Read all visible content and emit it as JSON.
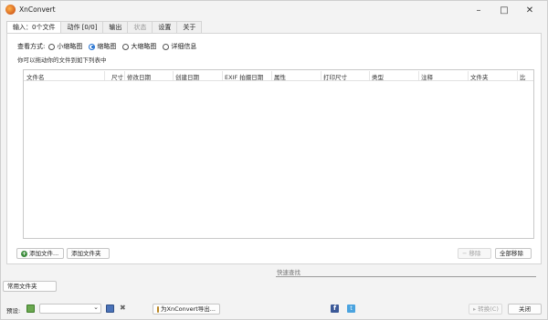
{
  "window": {
    "title": "XnConvert"
  },
  "tabs": [
    {
      "label": "输入：0个文件",
      "state": "active"
    },
    {
      "label": "动作 [0/0]",
      "state": "normal"
    },
    {
      "label": "输出",
      "state": "normal"
    },
    {
      "label": "状态",
      "state": "disabled"
    },
    {
      "label": "设置",
      "state": "normal"
    },
    {
      "label": "关于",
      "state": "normal"
    }
  ],
  "view_mode": {
    "label": "查看方式:",
    "options": [
      {
        "label": "小缩略图",
        "selected": false
      },
      {
        "label": "缩略图",
        "selected": true
      },
      {
        "label": "大缩略图",
        "selected": false
      },
      {
        "label": "详细信息",
        "selected": false
      }
    ]
  },
  "hint": "你可以拖动你的文件到如下列表中",
  "file_list": {
    "columns": [
      "文件名",
      "尺寸",
      "修改日期",
      "创建日期",
      "EXIF 拍摄日期",
      "属性",
      "打印尺寸",
      "类型",
      "注释",
      "文件夹",
      "比"
    ]
  },
  "buttons": {
    "add_file": "添加文件...",
    "add_folder": "添加文件夹",
    "remove": "移除",
    "remove_all": "全部移除",
    "common_folders": "常用文件夹",
    "export": "为XnConvert导出...",
    "convert": "转换(C)",
    "close": "关闭"
  },
  "filter": {
    "placeholder": "快速查找"
  },
  "preset": {
    "label": "预设:",
    "value": ""
  },
  "colors": {
    "accent": "#1f6fd1",
    "add_icon": "#3c8c3c",
    "facebook": "#3b5998",
    "twitter": "#4aa3df"
  }
}
